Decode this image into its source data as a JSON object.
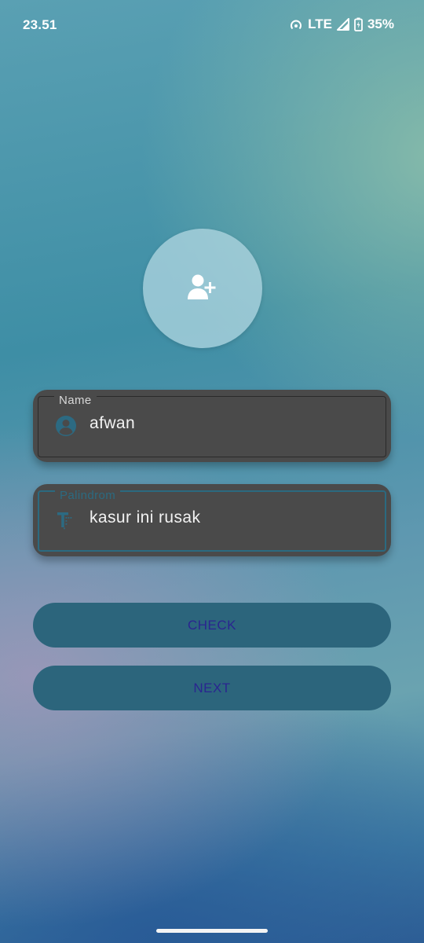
{
  "status_bar": {
    "time": "23.51",
    "network": "LTE",
    "battery": "35%",
    "icons": [
      "hotspot-icon",
      "signal-icon",
      "battery-charging-icon"
    ]
  },
  "avatar": {
    "icon": "add-user-icon"
  },
  "form": {
    "name": {
      "label": "Name",
      "value": "afwan",
      "icon": "account-circle-icon"
    },
    "palindrome": {
      "label": "Palindrom",
      "value": "kasur ini rusak",
      "icon": "text-fields-icon"
    }
  },
  "buttons": {
    "check_label": "CHECK",
    "next_label": "NEXT"
  },
  "colors": {
    "card": "#4a4a4a",
    "button": "#2c657c",
    "button_text": "#2a2590",
    "accent_outline": "#2b6a80"
  }
}
